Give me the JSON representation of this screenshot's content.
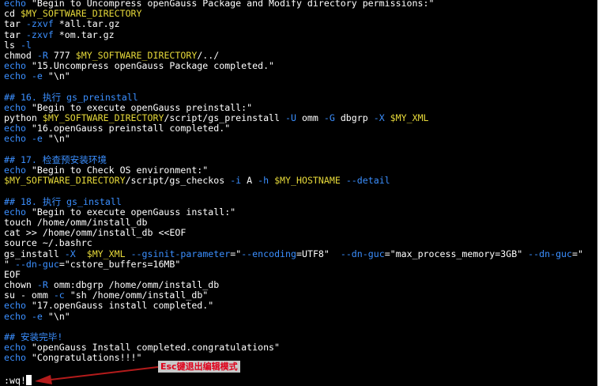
{
  "colors": {
    "background": "#000000",
    "text": "#ffffff",
    "command": "#ffffff",
    "keyword": "#3b8fff",
    "string": "#ffffff",
    "variable": "#e6d93a",
    "option": "#3b8fff",
    "comment": "#3b8fff",
    "annotation_text": "#e0001a",
    "annotation_bg": "#c8c8c8",
    "arrow": "#b31b1b"
  },
  "editor_lines": [
    [
      {
        "t": "echo",
        "c": "keyword"
      },
      {
        "t": " \"Begin to Uncompress openGauss Package and Modify directory permissions:\"",
        "c": "string"
      }
    ],
    [
      {
        "t": "cd ",
        "c": "command"
      },
      {
        "t": "$MY_SOFTWARE_DIRECTORY",
        "c": "variable"
      }
    ],
    [
      {
        "t": "tar ",
        "c": "command"
      },
      {
        "t": "-zxvf",
        "c": "option"
      },
      {
        "t": " *all.tar.gz",
        "c": "command"
      }
    ],
    [
      {
        "t": "tar ",
        "c": "command"
      },
      {
        "t": "-zxvf",
        "c": "option"
      },
      {
        "t": " *om.tar.gz",
        "c": "command"
      }
    ],
    [
      {
        "t": "ls ",
        "c": "command"
      },
      {
        "t": "-l",
        "c": "option"
      }
    ],
    [
      {
        "t": "chmod ",
        "c": "command"
      },
      {
        "t": "-R",
        "c": "option"
      },
      {
        "t": " 777 ",
        "c": "command"
      },
      {
        "t": "$MY_SOFTWARE_DIRECTORY",
        "c": "variable"
      },
      {
        "t": "/../",
        "c": "command"
      }
    ],
    [
      {
        "t": "echo",
        "c": "keyword"
      },
      {
        "t": " \"15.Uncompress openGauss Package completed.\"",
        "c": "string"
      }
    ],
    [
      {
        "t": "echo",
        "c": "keyword"
      },
      {
        "t": " ",
        "c": "command"
      },
      {
        "t": "-e",
        "c": "option"
      },
      {
        "t": " \"\\n\"",
        "c": "string"
      }
    ],
    [],
    [
      {
        "t": "## 16. 执行 gs_preinstall",
        "c": "comment"
      }
    ],
    [
      {
        "t": "echo",
        "c": "keyword"
      },
      {
        "t": " \"Begin to execute openGauss preinstall:\"",
        "c": "string"
      }
    ],
    [
      {
        "t": "python ",
        "c": "command"
      },
      {
        "t": "$MY_SOFTWARE_DIRECTORY",
        "c": "variable"
      },
      {
        "t": "/script/gs_preinstall ",
        "c": "command"
      },
      {
        "t": "-U",
        "c": "option"
      },
      {
        "t": " omm ",
        "c": "command"
      },
      {
        "t": "-G",
        "c": "option"
      },
      {
        "t": " dbgrp ",
        "c": "command"
      },
      {
        "t": "-X",
        "c": "option"
      },
      {
        "t": " ",
        "c": "command"
      },
      {
        "t": "$MY_XML",
        "c": "variable"
      }
    ],
    [
      {
        "t": "echo",
        "c": "keyword"
      },
      {
        "t": " \"16.openGauss preinstall completed.\"",
        "c": "string"
      }
    ],
    [
      {
        "t": "echo",
        "c": "keyword"
      },
      {
        "t": " ",
        "c": "command"
      },
      {
        "t": "-e",
        "c": "option"
      },
      {
        "t": " \"\\n\"",
        "c": "string"
      }
    ],
    [],
    [
      {
        "t": "## 17. 检查预安装环境",
        "c": "comment"
      }
    ],
    [
      {
        "t": "echo",
        "c": "keyword"
      },
      {
        "t": " \"Begin to Check OS environment:\"",
        "c": "string"
      }
    ],
    [
      {
        "t": "$MY_SOFTWARE_DIRECTORY",
        "c": "variable"
      },
      {
        "t": "/script/gs_checkos ",
        "c": "command"
      },
      {
        "t": "-i",
        "c": "option"
      },
      {
        "t": " A ",
        "c": "command"
      },
      {
        "t": "-h",
        "c": "option"
      },
      {
        "t": " ",
        "c": "command"
      },
      {
        "t": "$MY_HOSTNAME",
        "c": "variable"
      },
      {
        "t": " ",
        "c": "command"
      },
      {
        "t": "--detail",
        "c": "option"
      }
    ],
    [],
    [
      {
        "t": "## 18. 执行 gs_install",
        "c": "comment"
      }
    ],
    [
      {
        "t": "echo",
        "c": "keyword"
      },
      {
        "t": " \"Begin to execute openGauss install:\"",
        "c": "string"
      }
    ],
    [
      {
        "t": "touch /home/omm/install_db",
        "c": "command"
      }
    ],
    [
      {
        "t": "cat >> /home/omm/install_db <<EOF",
        "c": "command"
      }
    ],
    [
      {
        "t": "source ~/.bashrc",
        "c": "command"
      }
    ],
    [
      {
        "t": "gs_install ",
        "c": "command"
      },
      {
        "t": "-X",
        "c": "option"
      },
      {
        "t": "  ",
        "c": "command"
      },
      {
        "t": "$MY_XML",
        "c": "variable"
      },
      {
        "t": " ",
        "c": "command"
      },
      {
        "t": "--gsinit-parameter",
        "c": "option"
      },
      {
        "t": "=\"",
        "c": "command"
      },
      {
        "t": "--encoding",
        "c": "option"
      },
      {
        "t": "=UTF8\"  ",
        "c": "command"
      },
      {
        "t": "--dn-guc",
        "c": "option"
      },
      {
        "t": "=\"max_process_memory=3GB\" ",
        "c": "command"
      },
      {
        "t": "--dn-guc",
        "c": "option"
      },
      {
        "t": "=\"",
        "c": "command"
      }
    ],
    [
      {
        "t": "\" ",
        "c": "command"
      },
      {
        "t": "--dn-guc",
        "c": "option"
      },
      {
        "t": "=\"cstore_buffers=16MB\"",
        "c": "command"
      }
    ],
    [
      {
        "t": "EOF",
        "c": "command"
      }
    ],
    [
      {
        "t": "chown ",
        "c": "command"
      },
      {
        "t": "-R",
        "c": "option"
      },
      {
        "t": " omm:dbgrp /home/omm/install_db",
        "c": "command"
      }
    ],
    [
      {
        "t": "su - omm ",
        "c": "command"
      },
      {
        "t": "-c",
        "c": "option"
      },
      {
        "t": " \"sh /home/omm/install_db\"",
        "c": "string"
      }
    ],
    [
      {
        "t": "echo",
        "c": "keyword"
      },
      {
        "t": " \"17.openGauss install completed.\"",
        "c": "string"
      }
    ],
    [
      {
        "t": "echo",
        "c": "keyword"
      },
      {
        "t": " ",
        "c": "command"
      },
      {
        "t": "-e",
        "c": "option"
      },
      {
        "t": " \"\\n\"",
        "c": "string"
      }
    ],
    [],
    [
      {
        "t": "## 安装完毕!",
        "c": "comment"
      }
    ],
    [
      {
        "t": "echo",
        "c": "keyword"
      },
      {
        "t": " \"openGauss Install completed.congratulations\"",
        "c": "string"
      }
    ],
    [
      {
        "t": "echo",
        "c": "keyword"
      },
      {
        "t": " \"Congratulations!!!\"",
        "c": "string"
      }
    ]
  ],
  "annotation": {
    "label": "Esc键退出编辑模式"
  },
  "command_line": {
    "text": ":wq!"
  }
}
